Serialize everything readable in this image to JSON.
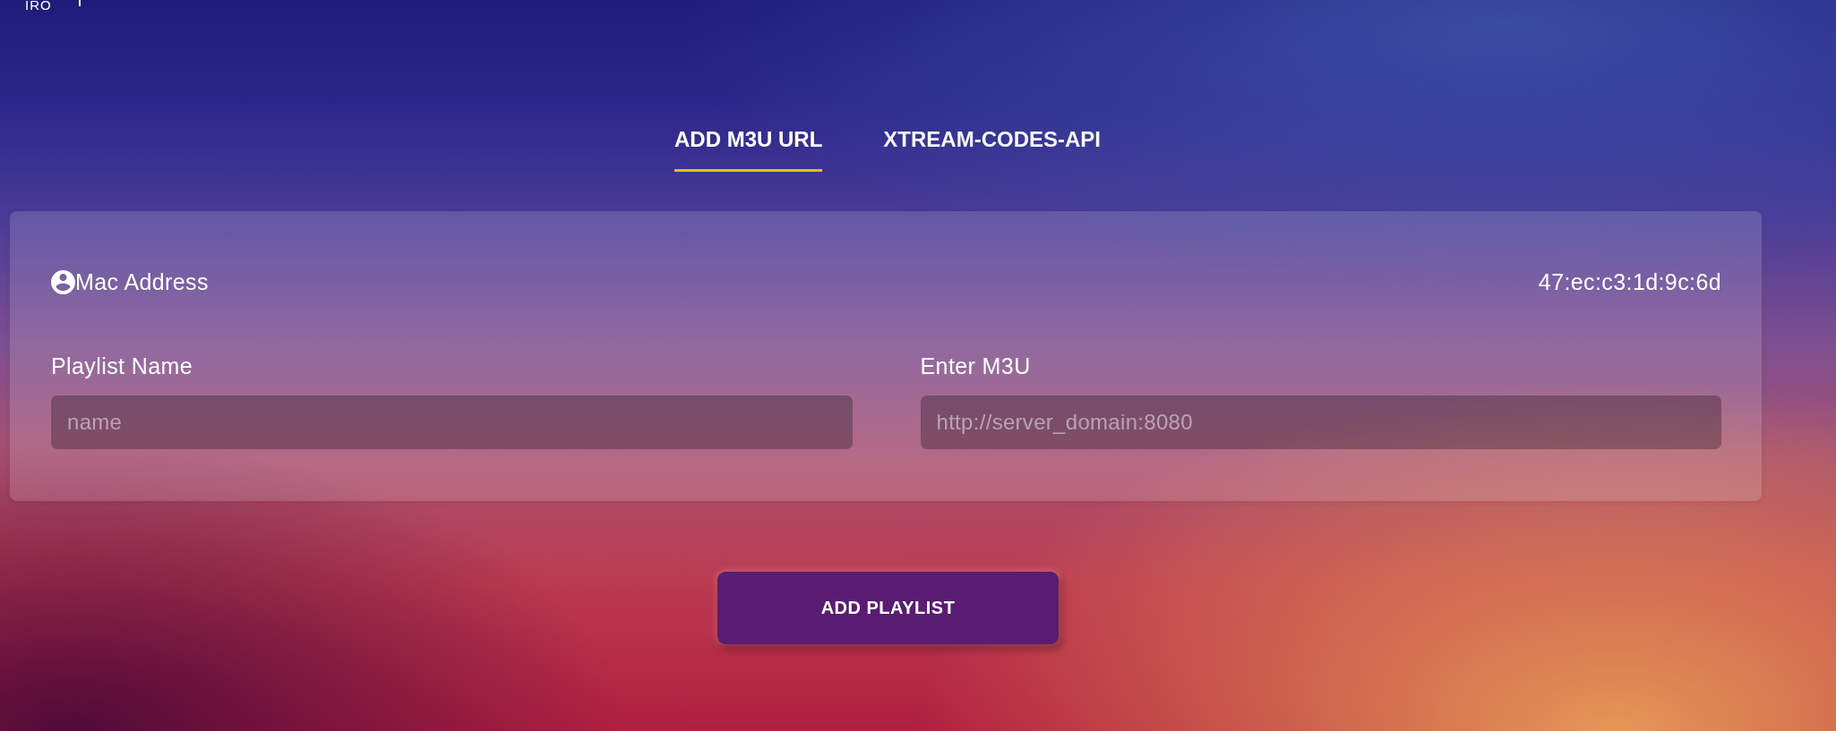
{
  "header": {
    "logo": "IRO"
  },
  "tabs": [
    {
      "label": "ADD M3U URL",
      "selected": true
    },
    {
      "label": "XTREAM-CODES-API",
      "selected": false
    }
  ],
  "device": {
    "label": "Mac Address",
    "value": "47:ec:c3:1d:9c:6d"
  },
  "fields": [
    {
      "label": "Playlist Name",
      "placeholder": "name"
    },
    {
      "label": "Enter M3U",
      "placeholder": "http://server_domain:8080"
    }
  ],
  "button": {
    "label": "ADD PLAYLIST"
  }
}
